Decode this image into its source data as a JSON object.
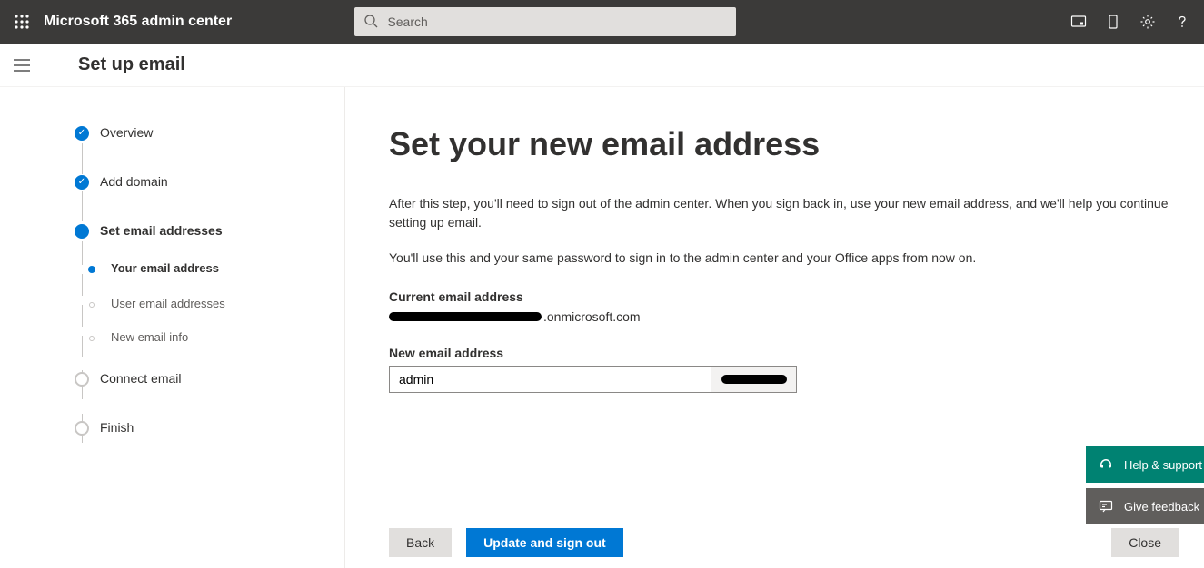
{
  "header": {
    "title": "Microsoft 365 admin center",
    "search_placeholder": "Search"
  },
  "subheader": {
    "title": "Set up email"
  },
  "steps": {
    "overview": "Overview",
    "add_domain": "Add domain",
    "set_email_addresses": "Set email addresses",
    "your_email_address": "Your email address",
    "user_email_addresses": "User email addresses",
    "new_email_info": "New email info",
    "connect_email": "Connect email",
    "finish": "Finish"
  },
  "content": {
    "title": "Set your new email address",
    "p1": "After this step, you'll need to sign out of the admin center. When you sign back in, use your new email address, and we'll help you continue setting up email.",
    "p2": "You'll use this and your same password to sign in to the admin center and your Office apps from now on.",
    "current_label": "Current email address",
    "current_suffix": ".onmicrosoft.com",
    "new_label": "New email address",
    "new_value": "admin"
  },
  "footer": {
    "back": "Back",
    "update": "Update and sign out",
    "close": "Close"
  },
  "float": {
    "help": "Help & support",
    "feedback": "Give feedback"
  }
}
